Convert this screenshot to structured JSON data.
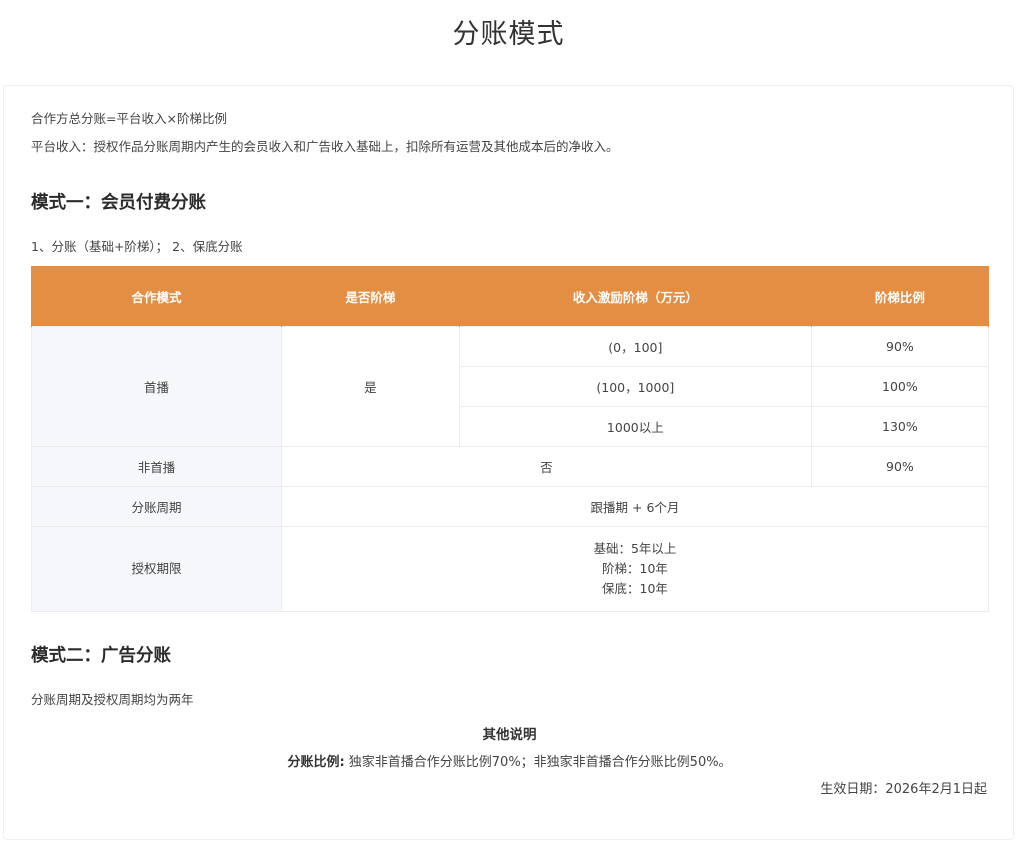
{
  "page_title": "分账模式",
  "intro": {
    "formula": "合作方总分账=平台收入×阶梯比例",
    "definition": "平台收入：授权作品分账周期内产生的会员收入和广告收入基础上，扣除所有运营及其他成本后的净收入。"
  },
  "mode1": {
    "heading": "模式一：会员付费分账",
    "subtext": "1、分账（基础+阶梯）； 2、保底分账",
    "table": {
      "headers": [
        "合作模式",
        "是否阶梯",
        "收入激励阶梯（万元）",
        "阶梯比例"
      ],
      "premiere": {
        "label": "首播",
        "tiered": "是",
        "tiers": [
          {
            "range": "(0，100]",
            "ratio": "90%"
          },
          {
            "range": "(100，1000]",
            "ratio": "100%"
          },
          {
            "range": "1000以上",
            "ratio": "130%"
          }
        ]
      },
      "non_premiere": {
        "label": "非首播",
        "tiered": "否",
        "ratio": "90%"
      },
      "period": {
        "label": "分账周期",
        "value": "跟播期 + 6个月"
      },
      "license": {
        "label": "授权期限",
        "lines": [
          "基础：5年以上",
          "阶梯：10年",
          "保底：10年"
        ]
      }
    }
  },
  "mode2": {
    "heading": "模式二：广告分账",
    "subtext": "分账周期及授权周期均为两年"
  },
  "other": {
    "title": "其他说明",
    "ratio_label": "分账比例:",
    "ratio_text": " 独家非首播合作分账比例70%；非独家非首播合作分账比例50%。",
    "effective_date": "生效日期：2026年2月1日起"
  }
}
